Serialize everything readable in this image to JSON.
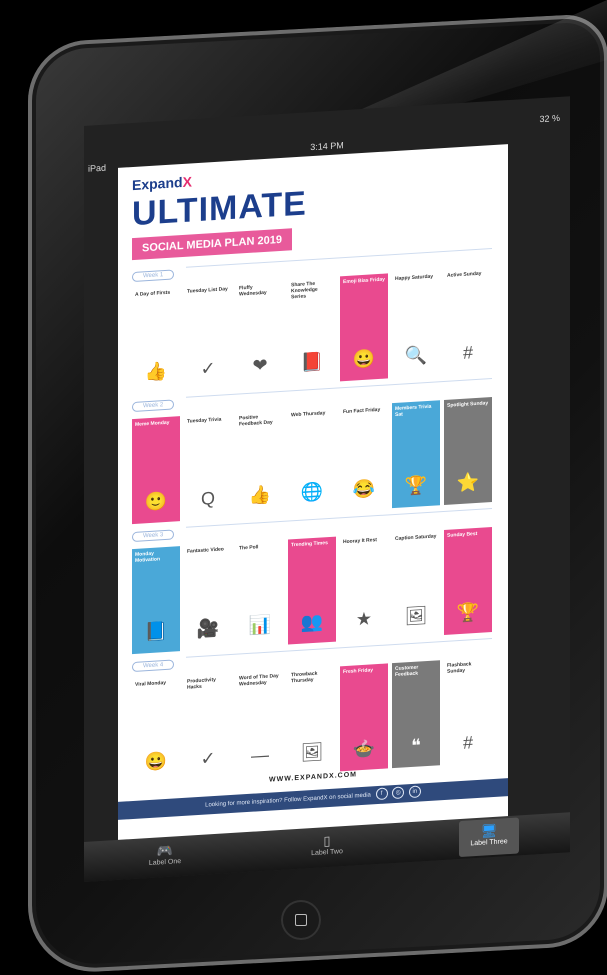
{
  "statusbar": {
    "carrier": "iPad",
    "time": "3:14 PM",
    "battery": "32 %"
  },
  "hero": {
    "brand_a": "Expand",
    "brand_b": "X",
    "title": "ULTIMATE",
    "subtitle": "SOCIAL MEDIA PLAN 2019"
  },
  "weeks": [
    {
      "label": "Week 1",
      "days": [
        {
          "title": "A Day of Firsts",
          "style": "white",
          "icon": "👍"
        },
        {
          "title": "Tuesday List Day",
          "style": "white",
          "icon": "✓"
        },
        {
          "title": "Fluffy Wednesday",
          "style": "white",
          "icon": "❤"
        },
        {
          "title": "Share The Knowledge Series",
          "style": "white",
          "icon": "📕"
        },
        {
          "title": "Emoji Bias Friday",
          "style": "pink",
          "icon": "😀"
        },
        {
          "title": "Happy Saturday",
          "style": "white",
          "icon": "🔍"
        },
        {
          "title": "Active Sunday",
          "style": "white",
          "icon": "#"
        }
      ]
    },
    {
      "label": "Week 2",
      "days": [
        {
          "title": "Meme Monday",
          "style": "pink",
          "icon": "🙂"
        },
        {
          "title": "Tuesday Trivia",
          "style": "white",
          "icon": "Q"
        },
        {
          "title": "Positive Feedback Day",
          "style": "white",
          "icon": "👍"
        },
        {
          "title": "Web Thursday",
          "style": "white",
          "icon": "🌐"
        },
        {
          "title": "Fun Fact Friday",
          "style": "white",
          "icon": "😂"
        },
        {
          "title": "Members Trivia Sat",
          "style": "blue",
          "icon": "🏆"
        },
        {
          "title": "Spotlight Sunday",
          "style": "gray",
          "icon": "⭐"
        }
      ]
    },
    {
      "label": "Week 3",
      "days": [
        {
          "title": "Monday Motivation",
          "style": "blue",
          "icon": "📘"
        },
        {
          "title": "Fantastic Video",
          "style": "white",
          "icon": "🎥"
        },
        {
          "title": "The Poll",
          "style": "white",
          "icon": "📊"
        },
        {
          "title": "Trending Times",
          "style": "pink",
          "icon": "👥"
        },
        {
          "title": "Hooray It Rest",
          "style": "white",
          "icon": "★"
        },
        {
          "title": "Caption Saturday",
          "style": "white",
          "icon": "🖼"
        },
        {
          "title": "Sunday Best",
          "style": "pink",
          "icon": "🏆"
        }
      ]
    },
    {
      "label": "Week 4",
      "days": [
        {
          "title": "Viral Monday",
          "style": "white",
          "icon": "😀"
        },
        {
          "title": "Productivity Hacks",
          "style": "white",
          "icon": "✓"
        },
        {
          "title": "Word of The Day Wednesday",
          "style": "white",
          "icon": "—"
        },
        {
          "title": "Throwback Thursday",
          "style": "white",
          "icon": "🖼"
        },
        {
          "title": "Fresh Friday",
          "style": "pink",
          "icon": "🍲"
        },
        {
          "title": "Customer Feedback",
          "style": "gray",
          "icon": "❝"
        },
        {
          "title": "Flashback Sunday",
          "style": "white",
          "icon": "#"
        }
      ]
    }
  ],
  "footer": {
    "url": "WWW.EXPANDX.COM",
    "follow": "Looking for more inspiration? Follow ExpandX on social media",
    "social": [
      "f",
      "◎",
      "in"
    ]
  },
  "tabs": [
    {
      "label": "Label One",
      "icon": "gamepad-icon"
    },
    {
      "label": "Label Two",
      "icon": "ipod-icon"
    },
    {
      "label": "Label Three",
      "icon": "monitor-icon"
    }
  ],
  "colors": {
    "navy": "#1c3e8c",
    "pink": "#e94a8f",
    "blue": "#4aa8d8"
  }
}
